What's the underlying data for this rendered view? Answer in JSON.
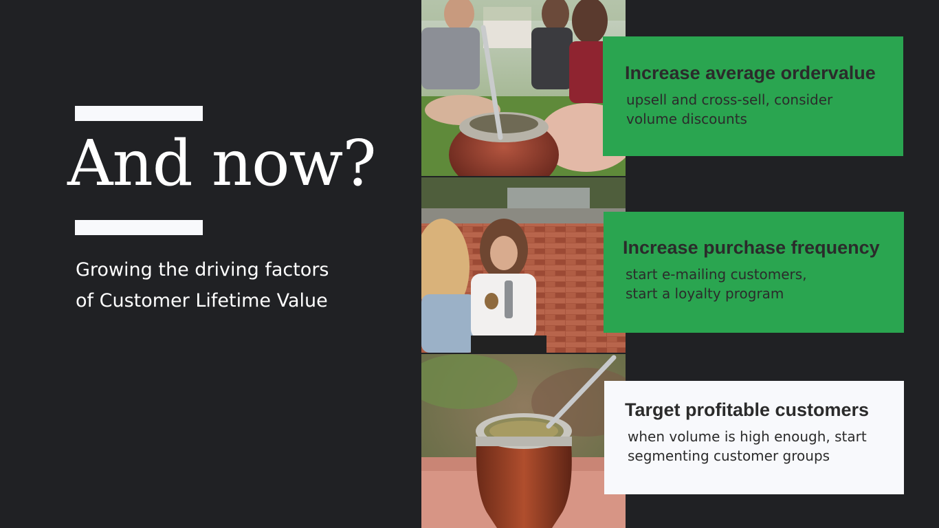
{
  "slide": {
    "title": "And now?",
    "subtitle_lines": [
      "Growing the driving factors",
      "of Customer Lifetime Value"
    ]
  },
  "cards": [
    {
      "title": "Increase average ordervalue",
      "lines": [
        "upsell and cross-sell, consider",
        "volume discounts"
      ],
      "color": "#2aa550"
    },
    {
      "title": "Increase purchase frequency",
      "lines": [
        "start e-mailing customers,",
        "start a loyalty program"
      ],
      "color": "#2aa550"
    },
    {
      "title": "Target profitable customers",
      "lines": [
        "when volume is high enough, start",
        "segmenting customer groups"
      ],
      "color": "#f8f9fc"
    }
  ],
  "colors": {
    "background": "#202124",
    "accent": "#2aa550",
    "light": "#f8f9fc",
    "text_dark": "#2b2b2b"
  }
}
